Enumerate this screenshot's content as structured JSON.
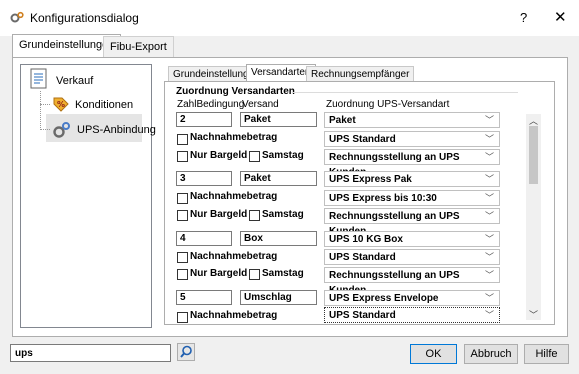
{
  "window": {
    "title": "Konfigurationsdialog",
    "help": "?",
    "close": "✕"
  },
  "outer_tabs": [
    "Grundeinstellungen",
    "Fibu-Export"
  ],
  "tree": {
    "root": "Verkauf",
    "children": [
      "Konditionen",
      "UPS-Anbindung"
    ],
    "selected": "UPS-Anbindung"
  },
  "inner_tabs": [
    "Grundeinstellungen",
    "Versandarten",
    "Rechnungsempfänger"
  ],
  "active_inner_tab": "Versandarten",
  "group": {
    "title": "Zuordnung Versandarten"
  },
  "columns": {
    "zahl": "ZahlBedingung",
    "versand": "Versand",
    "zuordnung": "Zuordnung UPS-Versandart"
  },
  "checkbox_labels": {
    "nachnahme": "Nachnahmebetrag",
    "bargeld": "Nur Bargeld",
    "samstag": "Samstag"
  },
  "rows": [
    {
      "zahl": "2",
      "versand": "Paket",
      "ups1": "Paket",
      "ups2": "UPS Standard",
      "ups3": "Rechnungsstellung an UPS Kunden"
    },
    {
      "zahl": "3",
      "versand": "Paket",
      "ups1": "UPS Express Pak",
      "ups2": "UPS Express bis 10:30",
      "ups3": "Rechnungsstellung an UPS Kunden"
    },
    {
      "zahl": "4",
      "versand": "Box",
      "ups1": "UPS 10 KG Box",
      "ups2": "UPS Standard",
      "ups3": "Rechnungsstellung an UPS Kunden"
    },
    {
      "zahl": "5",
      "versand": "Umschlag",
      "ups1": "UPS Express Envelope",
      "ups2": "UPS Standard"
    }
  ],
  "search": {
    "value": "ups"
  },
  "buttons": {
    "ok": "OK",
    "cancel": "Abbruch",
    "help": "Hilfe"
  }
}
